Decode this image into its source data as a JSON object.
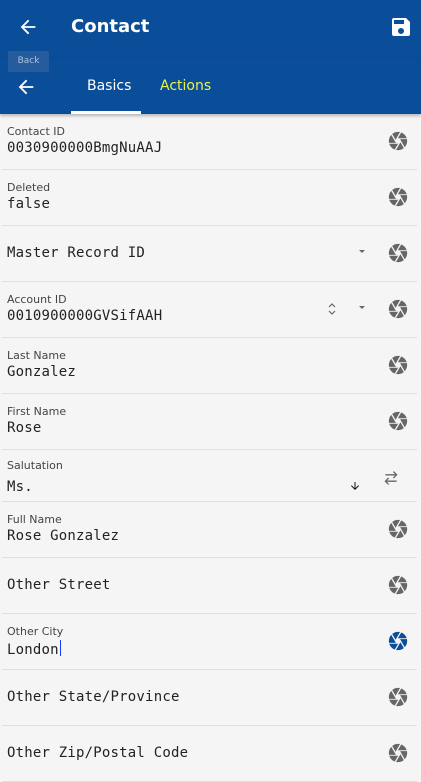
{
  "header": {
    "title": "Contact",
    "back_tooltip": "Back"
  },
  "tabs": [
    {
      "label": "Basics"
    },
    {
      "label": "Actions"
    }
  ],
  "fields": {
    "contact_id": {
      "label": "Contact ID",
      "value": "0030900000BmgNuAAJ"
    },
    "deleted": {
      "label": "Deleted",
      "value": "false"
    },
    "master_record_id": {
      "placeholder": "Master Record ID"
    },
    "account_id": {
      "label": "Account ID",
      "value": "0010900000GVSifAAH"
    },
    "last_name": {
      "label": "Last Name",
      "value": "Gonzalez"
    },
    "first_name": {
      "label": "First Name",
      "value": "Rose"
    },
    "salutation": {
      "label": "Salutation",
      "value": "Ms."
    },
    "full_name": {
      "label": "Full Name",
      "value": "Rose Gonzalez"
    },
    "other_street": {
      "placeholder": "Other Street"
    },
    "other_city": {
      "label": "Other City",
      "value": "London"
    },
    "other_state": {
      "placeholder": "Other State/Province"
    },
    "other_zip": {
      "placeholder": "Other Zip/Postal Code"
    }
  },
  "colors": {
    "primary": "#0a4d98",
    "active_tab": "#ffffff",
    "inactive_tab": "#e8f34a",
    "aperture": "#666666",
    "aperture_active": "#0a4d98"
  }
}
